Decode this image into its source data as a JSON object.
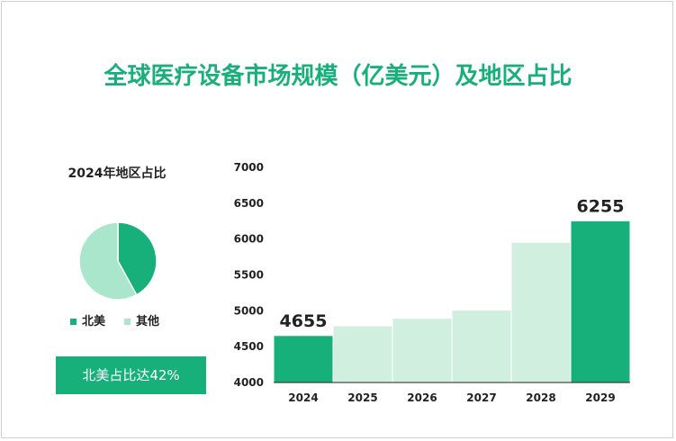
{
  "title": "全球医疗设备市场规模（亿美元）及地区占比",
  "pie": {
    "title": "2024年地区占比",
    "slices": [
      {
        "name": "北美",
        "value": 42,
        "color": "#17b07a"
      },
      {
        "name": "其他",
        "value": 58,
        "color": "#a9e6cc"
      }
    ],
    "badge": "北美占比达42%"
  },
  "chart_data": {
    "type": "bar",
    "categories": [
      "2024",
      "2025",
      "2026",
      "2027",
      "2028",
      "2029"
    ],
    "values": [
      4655,
      4790,
      4895,
      5010,
      5955,
      6255
    ],
    "highlight": [
      true,
      false,
      false,
      false,
      false,
      true
    ],
    "data_labels": {
      "2024": "4655",
      "2029": "6255"
    },
    "ylim": [
      4000,
      7000
    ],
    "yticks": [
      4000,
      4500,
      5000,
      5500,
      6000,
      6500,
      7000
    ],
    "colors": {
      "highlight": "#17b07a",
      "normal": "#d1efdf"
    }
  }
}
